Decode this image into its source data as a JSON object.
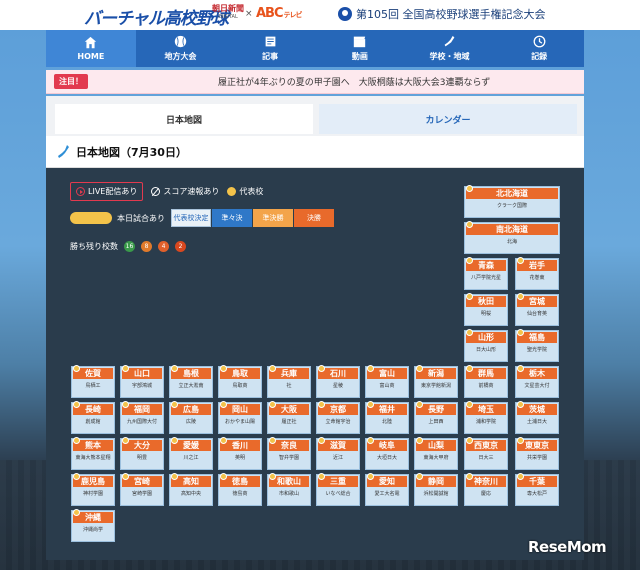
{
  "header": {
    "logo": "バーチャル高校野球",
    "partner1_main": "朝日新聞",
    "partner1_sub": "DIGITAL",
    "cross": "×",
    "partner2_main": "ABC",
    "partner2_sub": "テレビ",
    "tournament": "第105回 全国高校野球選手権記念大会"
  },
  "nav": [
    {
      "label": "HOME",
      "icon": "home-icon"
    },
    {
      "label": "地方大会",
      "icon": "baseball-icon"
    },
    {
      "label": "記事",
      "icon": "article-icon"
    },
    {
      "label": "動画",
      "icon": "video-icon"
    },
    {
      "label": "学校・地域",
      "icon": "japan-map-icon"
    },
    {
      "label": "記録",
      "icon": "record-icon"
    }
  ],
  "notice": {
    "badge": "注目！",
    "text": "履正社が4年ぶりの夏の甲子園へ　大阪桐蔭は大阪大会3連覇ならず"
  },
  "tabs": {
    "map": "日本地図",
    "calendar": "カレンダー"
  },
  "map_title": "日本地図（7月30日）",
  "legend": {
    "live": "LIVE配信あり",
    "score": "スコア速報あり",
    "representative": "代表校",
    "today": "本日試合あり",
    "stages": [
      "代表校決定",
      "準々決",
      "準決勝",
      "決勝"
    ],
    "remaining_label": "勝ち残り校数",
    "remaining": [
      {
        "value": "16",
        "color": "#3a9a4a"
      },
      {
        "value": "8",
        "color": "#e07a2b"
      },
      {
        "value": "4",
        "color": "#e0602b"
      },
      {
        "value": "2",
        "color": "#d9481f"
      }
    ]
  },
  "prefectures": [
    {
      "name": "北北海道",
      "school": "クラーク国際"
    },
    {
      "name": "南北海道",
      "school": "北海"
    },
    {
      "name": "青森",
      "school": "八戸学院光星"
    },
    {
      "name": "岩手",
      "school": "花巻東"
    },
    {
      "name": "秋田",
      "school": "明桜"
    },
    {
      "name": "宮城",
      "school": "仙台育英"
    },
    {
      "name": "山形",
      "school": "日大山形"
    },
    {
      "name": "福島",
      "school": "聖光学院"
    },
    {
      "name": "佐賀",
      "school": "鳥栖工"
    },
    {
      "name": "山口",
      "school": "宇部鴻城"
    },
    {
      "name": "島根",
      "school": "立正大淞南"
    },
    {
      "name": "鳥取",
      "school": "鳥取商"
    },
    {
      "name": "兵庫",
      "school": "社"
    },
    {
      "name": "石川",
      "school": "星稜"
    },
    {
      "name": "富山",
      "school": "富山商"
    },
    {
      "name": "新潟",
      "school": "東京学館新潟"
    },
    {
      "name": "群馬",
      "school": "前橋商"
    },
    {
      "name": "栃木",
      "school": "文星芸大付"
    },
    {
      "name": "長崎",
      "school": "創成館"
    },
    {
      "name": "福岡",
      "school": "九州国際大付"
    },
    {
      "name": "広島",
      "school": "広陵"
    },
    {
      "name": "岡山",
      "school": "おかやま山陽"
    },
    {
      "name": "大阪",
      "school": "履正社"
    },
    {
      "name": "京都",
      "school": "立命館宇治"
    },
    {
      "name": "福井",
      "school": "北陸"
    },
    {
      "name": "長野",
      "school": "上田西"
    },
    {
      "name": "埼玉",
      "school": "浦和学院"
    },
    {
      "name": "茨城",
      "school": "土浦日大"
    },
    {
      "name": "熊本",
      "school": "東海大熊本星翔"
    },
    {
      "name": "大分",
      "school": "明豊"
    },
    {
      "name": "愛媛",
      "school": "川之江"
    },
    {
      "name": "香川",
      "school": "英明"
    },
    {
      "name": "奈良",
      "school": "智弁学園"
    },
    {
      "name": "滋賀",
      "school": "近江"
    },
    {
      "name": "岐阜",
      "school": "大垣日大"
    },
    {
      "name": "山梨",
      "school": "東海大甲府"
    },
    {
      "name": "西東京",
      "school": "日大三"
    },
    {
      "name": "東東京",
      "school": "共栄学園"
    },
    {
      "name": "鹿児島",
      "school": "神村学園"
    },
    {
      "name": "宮崎",
      "school": "宮崎学園"
    },
    {
      "name": "高知",
      "school": "高知中央"
    },
    {
      "name": "徳島",
      "school": "徳島商"
    },
    {
      "name": "和歌山",
      "school": "市和歌山"
    },
    {
      "name": "三重",
      "school": "いなべ総合"
    },
    {
      "name": "愛知",
      "school": "愛工大名電"
    },
    {
      "name": "静岡",
      "school": "浜松開誠館"
    },
    {
      "name": "神奈川",
      "school": "慶応"
    },
    {
      "name": "千葉",
      "school": "専大松戸"
    },
    {
      "name": "沖縄",
      "school": "沖縄尚学"
    }
  ],
  "watermark": "ReseMom"
}
